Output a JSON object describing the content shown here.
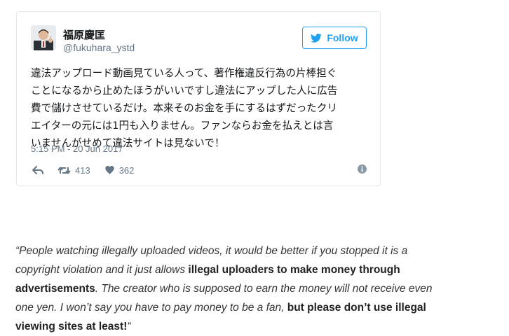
{
  "tweet": {
    "display_name": "福原慶匡",
    "handle": "@fukuhara_ystd",
    "follow_label": "Follow",
    "text_lines": [
      "違法アップロード動画見ている人って、著作権違反行為の片棒担ぐ",
      "ことになるから止めたほうがいいですし違法にアップした人に広告",
      "費で儲けさせているだけ。本来そのお金を手にするはずだったクリ",
      "エイターの元には1円も入りません。ファンならお金を払えとは言",
      "いませんがせめて違法サイトは見ないで！"
    ],
    "timestamp": "5:15 PM - 20 Jun 2017",
    "retweet_count": "413",
    "like_count": "362",
    "icons": {
      "follow": "twitter-bird-icon",
      "reply": "reply-icon",
      "retweet": "retweet-icon",
      "like": "heart-icon",
      "info": "info-icon"
    },
    "colors": {
      "accent": "#1da1f2",
      "muted": "#657786",
      "border": "#e1e8ed"
    }
  },
  "quote": {
    "line1": "“People watching illegally uploaded videos, it would be better if you stopped it is a",
    "line2_a": "copyright violation and it just allows ",
    "line2_b": "illegal uploaders to make money through",
    "line3_a": "advertisements",
    "line3_b": ". The creator who is supposed to earn the money will not receive even",
    "line4_a": "one yen. I won’t say you have to pay money to be a fan, ",
    "line4_b": "but please don’t use illegal",
    "line5_a": "viewing sites at least!",
    "line5_b": "“"
  }
}
